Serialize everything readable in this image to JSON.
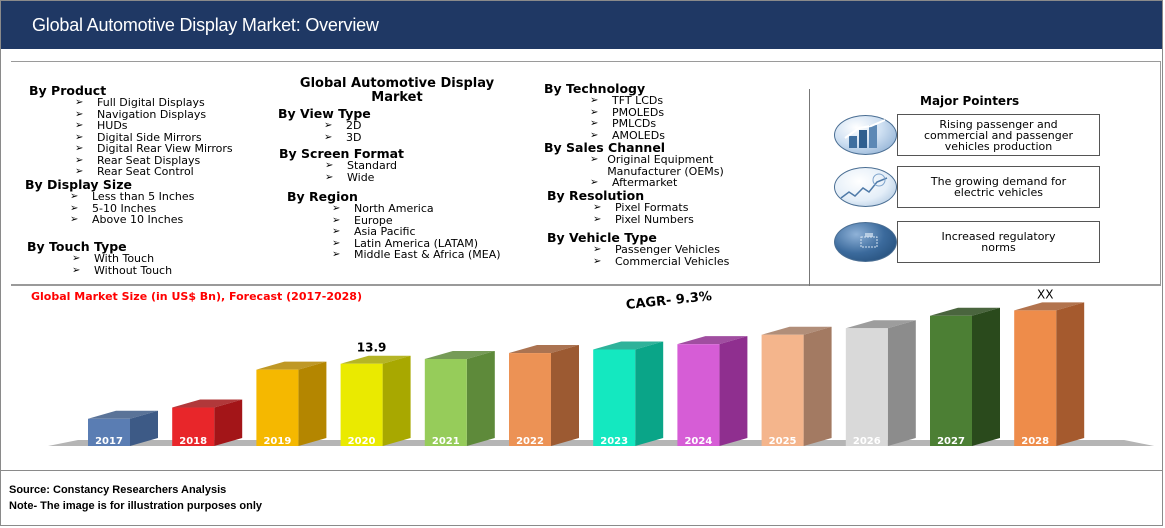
{
  "header": {
    "title": "Global Automotive Display Market: Overview"
  },
  "segmentation": {
    "center_title": "Global Automotive Display Market",
    "col1": [
      {
        "heading": "By Product",
        "items": [
          "Full Digital Displays",
          "Navigation Displays",
          "HUDs",
          "Digital Side Mirrors",
          "Digital Rear View Mirrors",
          "Rear Seat Displays",
          "Rear Seat Control"
        ]
      },
      {
        "heading": "By Display Size",
        "items": [
          "Less than 5 Inches",
          "5-10 Inches",
          "Above 10 Inches"
        ]
      },
      {
        "heading": "By Touch Type",
        "items": [
          "With Touch",
          "Without Touch"
        ]
      }
    ],
    "col2": [
      {
        "heading": "By View Type",
        "items": [
          "2D",
          "3D"
        ]
      },
      {
        "heading": "By Screen Format",
        "items": [
          "Standard",
          "Wide"
        ]
      },
      {
        "heading": "By Region",
        "items": [
          "North America",
          "Europe",
          "Asia Pacific",
          "Latin America (LATAM)",
          "Middle East & Africa (MEA)"
        ]
      }
    ],
    "col3": [
      {
        "heading": "By Technology",
        "items": [
          "TFT LCDs",
          "PMOLEDs",
          "PMLCDs",
          "AMOLEDs"
        ]
      },
      {
        "heading": "By Sales Channel",
        "items": [
          "Original Equipment Manufacturer (OEMs)",
          "Aftermarket"
        ]
      },
      {
        "heading": "By Resolution",
        "items": [
          "Pixel Formats",
          "Pixel Numbers"
        ]
      },
      {
        "heading": "By Vehicle Type",
        "items": [
          "Passenger Vehicles",
          "Commercial Vehicles"
        ]
      }
    ],
    "bullet_icon": "arrowhead-bullet"
  },
  "major_pointers": {
    "title": "Major Pointers",
    "items": [
      {
        "text": "Rising passenger and commercial and passenger vehicles production",
        "icon": "bar-chart-growth-icon"
      },
      {
        "text": "The growing demand for electric vehicles",
        "icon": "line-chart-icon"
      },
      {
        "text": "Increased regulatory norms",
        "icon": "regulation-icon"
      }
    ]
  },
  "chart_data": {
    "type": "bar",
    "title": "Global Market Size (in US$ Bn), Forecast (2017-2028)",
    "xlabel": "",
    "ylabel": "",
    "categories": [
      "2017",
      "2018",
      "2019",
      "2020",
      "2021",
      "2022",
      "2023",
      "2024",
      "2025",
      "2026",
      "2027",
      "2028"
    ],
    "values": [
      4.6,
      6.5,
      12.9,
      13.9,
      14.7,
      15.7,
      16.3,
      17.2,
      18.8,
      19.9,
      22.0,
      22.9
    ],
    "data_labels": {
      "2020": "13.9",
      "2028": "XX"
    },
    "annotation": "CAGR- 9.3%",
    "colors": [
      "#5a7db3",
      "#e8262a",
      "#f5b800",
      "#eaea00",
      "#96cc5a",
      "#ec9255",
      "#14e8c0",
      "#d65dd6",
      "#f4b58c",
      "#d9d9d9",
      "#4c7f34",
      "#ee8c4a"
    ],
    "side_colors": [
      "#3d5a86",
      "#a31518",
      "#b48600",
      "#a8a800",
      "#5e8a3a",
      "#9c5a32",
      "#0aa588",
      "#8f2f8f",
      "#a37a62",
      "#8c8c8c",
      "#2a4a1c",
      "#a55a2e"
    ],
    "grid": false,
    "legend": "none",
    "ylim": [
      0,
      25
    ]
  },
  "footer": {
    "source": "Source: Constancy Researchers Analysis",
    "note": "Note- The image is for illustration purposes only"
  }
}
